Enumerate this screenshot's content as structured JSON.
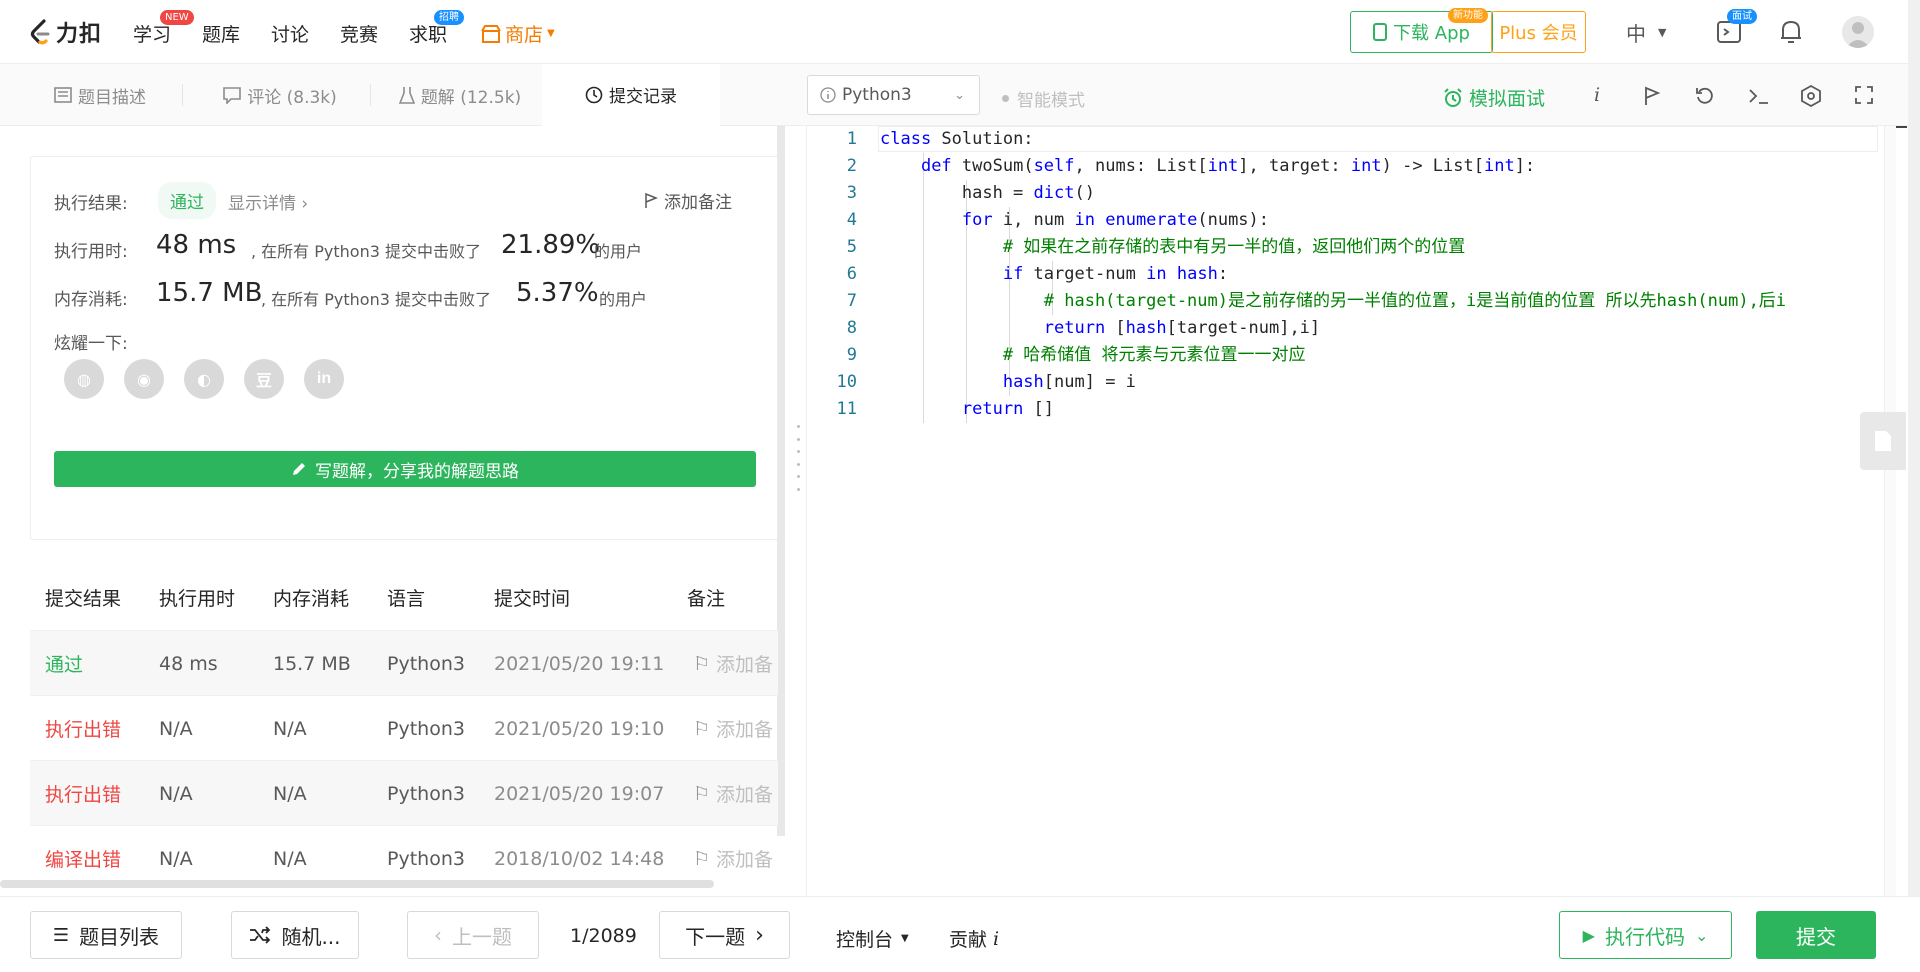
{
  "nav": {
    "logo_text": "力扣",
    "items": [
      {
        "label": "学习",
        "badge": "NEW"
      },
      {
        "label": "题库"
      },
      {
        "label": "讨论"
      },
      {
        "label": "竞赛"
      },
      {
        "label": "求职",
        "badge": "招聘"
      },
      {
        "label": "商店"
      }
    ],
    "download_app": "下载 App",
    "download_badge": "新功能",
    "plus_label": "Plus 会员",
    "lang_label": "中",
    "interview_badge": "面试"
  },
  "tabs": [
    {
      "label": "题目描述"
    },
    {
      "label": "评论 (8.3k)"
    },
    {
      "label": "题解 (12.5k)"
    },
    {
      "label": "提交记录"
    }
  ],
  "editor_toolbar": {
    "language": "Python3",
    "smart_mode": "智能模式",
    "mock_interview": "模拟面试"
  },
  "result": {
    "status_label": "执行结果:",
    "status_value": "通过",
    "details_link": "显示详情 ›",
    "add_note": "添加备注",
    "runtime_label": "执行用时:",
    "runtime_value": "48 ms",
    "runtime_text": ", 在所有 Python3 提交中击败了",
    "runtime_percent": "21.89%",
    "users": "的用户",
    "memory_label": "内存消耗:",
    "memory_value": "15.7 MB",
    "memory_text": ", 在所有 Python3 提交中击败了",
    "memory_percent": "5.37%",
    "share_label": "炫耀一下:",
    "share_icons": [
      "wechat-icon",
      "weibo-icon",
      "qq-icon",
      "douban-icon",
      "linkedin-icon"
    ],
    "share_glyphs": [
      "◍",
      "◉",
      "◐",
      "豆",
      "in"
    ],
    "write_solution": "写题解，分享我的解题思路"
  },
  "submissions": {
    "headers": [
      "提交结果",
      "执行用时",
      "内存消耗",
      "语言",
      "提交时间",
      "备注"
    ],
    "rows": [
      {
        "result": "通过",
        "status": "pass",
        "time": "48 ms",
        "memory": "15.7 MB",
        "lang": "Python3",
        "date": "2021/05/20 19:11",
        "note": "添加备"
      },
      {
        "result": "执行出错",
        "status": "fail",
        "time": "N/A",
        "memory": "N/A",
        "lang": "Python3",
        "date": "2021/05/20 19:10",
        "note": "添加备"
      },
      {
        "result": "执行出错",
        "status": "fail",
        "time": "N/A",
        "memory": "N/A",
        "lang": "Python3",
        "date": "2021/05/20 19:07",
        "note": "添加备"
      },
      {
        "result": "编译出错",
        "status": "fail",
        "time": "N/A",
        "memory": "N/A",
        "lang": "Python3",
        "date": "2018/10/02 14:48",
        "note": "添加备"
      }
    ]
  },
  "code": {
    "line_numbers": [
      "1",
      "2",
      "3",
      "4",
      "5",
      "6",
      "7",
      "8",
      "9",
      "10",
      "11"
    ],
    "l1a": "class",
    "l1b": " Solution:",
    "l2a": "    ",
    "l2b": "def",
    "l2c": " twoSum(",
    "l2d": "self",
    "l2e": ", nums: List[",
    "l2f": "int",
    "l2g": "], target: ",
    "l2h": "int",
    "l2i": ") -> List[",
    "l2j": "int",
    "l2k": "]:",
    "l3a": "        hash = ",
    "l3b": "dict",
    "l3c": "()",
    "l4a": "        ",
    "l4b": "for",
    "l4c": " i, num ",
    "l4d": "in",
    "l4e": " ",
    "l4f": "enumerate",
    "l4g": "(nums):",
    "l5a": "            ",
    "l5b": "# 如果在之前存储的表中有另一半的值，返回他们两个的位置",
    "l6a": "            ",
    "l6b": "if",
    "l6c": " target-num ",
    "l6d": "in",
    "l6e": " ",
    "l6f": "hash",
    "l6g": ":",
    "l7a": "                ",
    "l7b": "# hash(target-num)是之前存储的另一半值的位置，i是当前值的位置 所以先hash(num),后i",
    "l8a": "                ",
    "l8b": "return",
    "l8c": " [",
    "l8d": "hash",
    "l8e": "[target-num],i]",
    "l9a": "            ",
    "l9b": "# 哈希储值 将元素与元素位置一一对应",
    "l10a": "            ",
    "l10b": "hash",
    "l10c": "[num] = i",
    "l11a": "        ",
    "l11b": "return",
    "l11c": " []"
  },
  "bottom": {
    "problem_list": "题目列表",
    "random": "随机...",
    "prev": "上一题",
    "page": "1/2089",
    "next": "下一题",
    "console": "控制台",
    "contribute": "贡献",
    "run_code": "执行代码",
    "submit": "提交"
  },
  "colors": {
    "accent": "#2db55d",
    "fail": "#ef4743",
    "shop": "#f57c00",
    "badge_new": "#ef4743",
    "badge_blue": "#1890ff"
  }
}
